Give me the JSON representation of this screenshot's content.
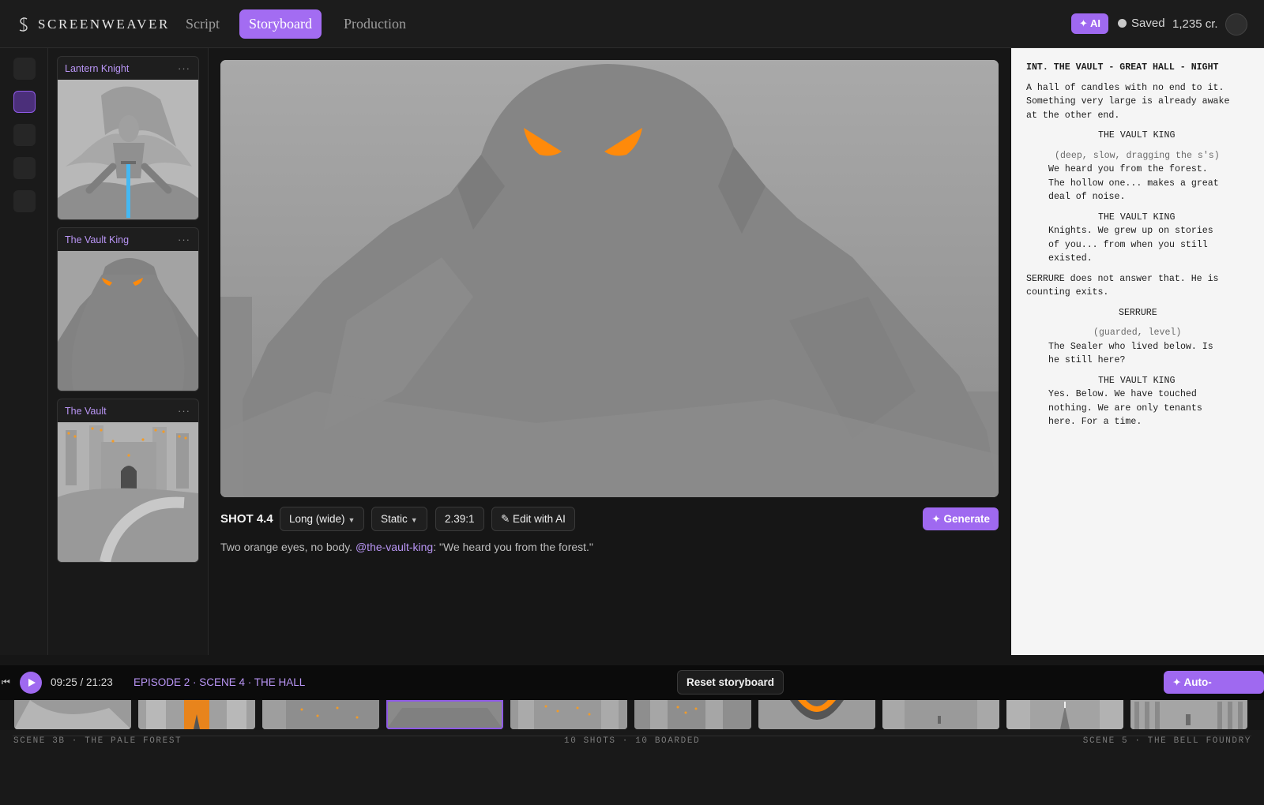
{
  "app": {
    "name": "SCREENWEAVER"
  },
  "nav": {
    "tabs": [
      {
        "label": "Script"
      },
      {
        "label": "Storyboard"
      },
      {
        "label": "Production"
      }
    ]
  },
  "status": {
    "ai_label": "✦ AI",
    "saved_label": "Saved",
    "credits": "1,235 cr."
  },
  "assets": [
    {
      "name": "Lantern Knight",
      "menu": "···",
      "image": "knight-figure-with-glowing-sword"
    },
    {
      "name": "The Vault King",
      "menu": "···",
      "image": "hooded-giant-with-orange-eyes"
    },
    {
      "name": "The Vault",
      "menu": "···",
      "image": "gothic-castle-with-candles"
    }
  ],
  "shot": {
    "id": "SHOT 4.4",
    "framing": "Long (wide)",
    "movement": "Static",
    "aspect": "2.39:1",
    "edit_label": "✎ Edit with AI",
    "generate_label": "✦ Generate",
    "description_prefix": "Two orange eyes, no body. ",
    "mention": "@the-vault-king",
    "description_suffix": ": \"We heard you from the forest.\""
  },
  "script": {
    "heading": "INT. THE VAULT - GREAT HALL - NIGHT",
    "action_1": [
      "A hall of candles with no end to it.",
      "Something very large is already awake",
      "at the other end."
    ],
    "char_1": "THE VAULT KING",
    "paren_1": "(deep, slow, dragging the s's)",
    "dial_1": [
      "We heard you from the forest.",
      "The hollow one... makes a great",
      "deal of noise."
    ],
    "char_2": "THE VAULT KING",
    "dial_2": [
      "Knights. We grew up on stories",
      "of you... from when you still",
      "existed."
    ],
    "action_2": [
      "SERRURE does not answer that. He is",
      "counting exits."
    ],
    "char_3": "SERRURE",
    "paren_3": "(guarded, level)",
    "dial_3": [
      "The Sealer who lived below. Is",
      "he still here?"
    ],
    "char_4": "THE VAULT KING",
    "dial_4": [
      "Yes. Below. We have touched",
      "nothing. We are only tenants",
      "here. For a time."
    ]
  },
  "timeline": {
    "time": "09:25 / 21:23",
    "episode": "EPISODE 2 · SCENE 4 · THE HALL",
    "reset_label": "Reset storyboard",
    "autogen_label": "✦ Auto-generate",
    "prev_scene": "SCENE 3B · THE PALE FOREST",
    "stats": "10 SHOTS · 10 BOARDED",
    "next_scene": "SCENE 5 · THE BELL FOUNDRY",
    "active_frame": 4
  },
  "colors": {
    "accent": "#9f69f0",
    "accent_text": "#b995f5",
    "eyes": "#ff8a0a",
    "background": "#161616"
  }
}
